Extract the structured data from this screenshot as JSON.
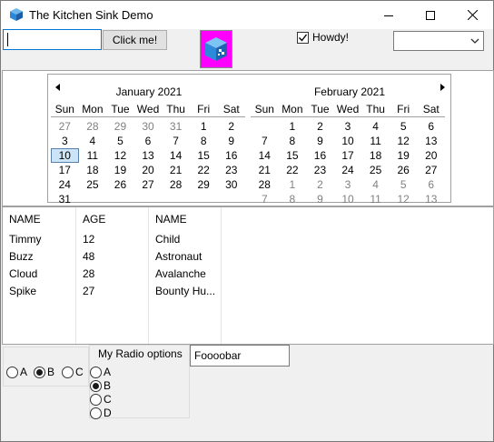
{
  "window": {
    "title": "The Kitchen Sink Demo",
    "app_icon": "cube-icon"
  },
  "toolbar": {
    "input_value": "",
    "button_label": "Click me!",
    "picture_icon": "cube-icon",
    "checkbox_label": "Howdy!",
    "checkbox_checked": true,
    "combo_value": ""
  },
  "calendar": {
    "dow": [
      "Sun",
      "Mon",
      "Tue",
      "Wed",
      "Thu",
      "Fri",
      "Sat"
    ],
    "months": [
      {
        "title": "January 2021",
        "weeks": [
          [
            "27",
            "28",
            "29",
            "30",
            "31",
            "1",
            "2"
          ],
          [
            "3",
            "4",
            "5",
            "6",
            "7",
            "8",
            "9"
          ],
          [
            "10",
            "11",
            "12",
            "13",
            "14",
            "15",
            "16"
          ],
          [
            "17",
            "18",
            "19",
            "20",
            "21",
            "22",
            "23"
          ],
          [
            "24",
            "25",
            "26",
            "27",
            "28",
            "29",
            "30"
          ],
          [
            "31",
            "",
            "",
            "",
            "",
            "",
            ""
          ]
        ],
        "dim": [
          [
            0,
            0
          ],
          [
            0,
            1
          ],
          [
            0,
            2
          ],
          [
            0,
            3
          ],
          [
            0,
            4
          ]
        ],
        "today": [
          2,
          0
        ]
      },
      {
        "title": "February 2021",
        "weeks": [
          [
            "",
            "1",
            "2",
            "3",
            "4",
            "5",
            "6"
          ],
          [
            "7",
            "8",
            "9",
            "10",
            "11",
            "12",
            "13"
          ],
          [
            "14",
            "15",
            "16",
            "17",
            "18",
            "19",
            "20"
          ],
          [
            "21",
            "22",
            "23",
            "24",
            "25",
            "26",
            "27"
          ],
          [
            "28",
            "1",
            "2",
            "3",
            "4",
            "5",
            "6"
          ],
          [
            "7",
            "8",
            "9",
            "10",
            "11",
            "12",
            "13"
          ]
        ],
        "dim": [
          [
            4,
            1
          ],
          [
            4,
            2
          ],
          [
            4,
            3
          ],
          [
            4,
            4
          ],
          [
            4,
            5
          ],
          [
            4,
            6
          ],
          [
            5,
            0
          ],
          [
            5,
            1
          ],
          [
            5,
            2
          ],
          [
            5,
            3
          ],
          [
            5,
            4
          ],
          [
            5,
            5
          ],
          [
            5,
            6
          ]
        ],
        "today": null
      }
    ]
  },
  "list": {
    "columns": [
      "NAME",
      "AGE",
      "NAME"
    ],
    "rows": [
      [
        "Timmy",
        "12",
        "Child"
      ],
      [
        "Buzz",
        "48",
        "Astronaut"
      ],
      [
        "Cloud",
        "28",
        "Avalanche"
      ],
      [
        "Spike",
        "27",
        "Bounty Hu..."
      ]
    ]
  },
  "radio_row": {
    "options": [
      "A",
      "B",
      "C"
    ],
    "selected": "B"
  },
  "radio_group": {
    "title": "My Radio options",
    "options": [
      "A",
      "B",
      "C",
      "D"
    ],
    "selected": "B"
  },
  "text_field": {
    "value": "Foooobar"
  }
}
